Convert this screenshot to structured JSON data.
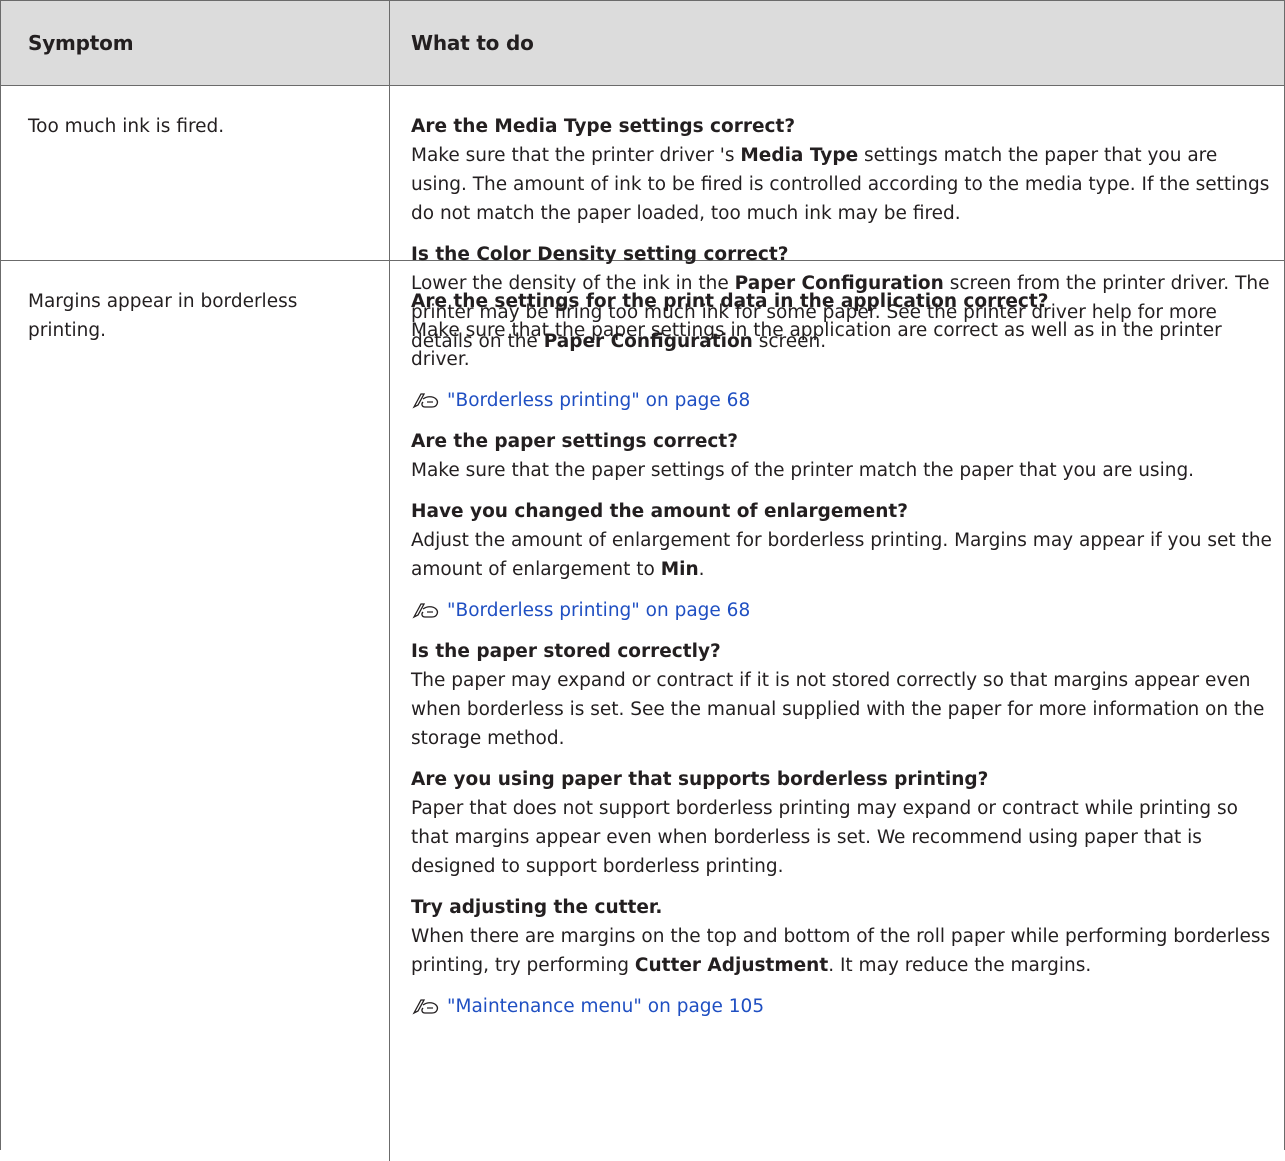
{
  "header": {
    "symptom": "Symptom",
    "what_to_do": "What to do"
  },
  "rows": [
    {
      "symptom": "Too much ink is fired.",
      "blocks": [
        {
          "question": "Are the Media Type settings correct?",
          "text_parts": [
            "Make sure that the printer driver 's ",
            "Media Type",
            " settings match the paper that you are using. The amount of ink to be fired is controlled according to the media type. If the settings do not match the paper loaded, too much ink may be fired."
          ]
        },
        {
          "question": "Is the Color Density setting correct?",
          "text_parts": [
            "Lower the density of the ink in the ",
            "Paper Configuration",
            " screen from the printer driver. The printer may be firing too much ink for some paper. See the printer driver help for more details on the ",
            "Paper Configuration",
            " screen."
          ]
        }
      ]
    },
    {
      "symptom": "Margins appear in borderless printing.",
      "blocks": [
        {
          "question": "Are the settings for the print data in the application correct?",
          "text": "Make sure that the paper settings in the application are correct as well as in the printer driver."
        },
        {
          "link": "\"Borderless printing\" on page 68"
        },
        {
          "question": "Are the paper settings correct?",
          "text": "Make sure that the paper settings of the printer match the paper that you are using."
        },
        {
          "question": "Have you changed the amount of enlargement?",
          "text_parts": [
            "Adjust the amount of enlargement for borderless printing. Margins may appear if you set the amount of enlargement to ",
            "Min",
            "."
          ]
        },
        {
          "link": "\"Borderless printing\" on page 68"
        },
        {
          "question": "Is the paper stored correctly?",
          "text": "The paper may expand or contract if it is not stored correctly so that margins appear even when borderless is set. See the manual supplied with the paper for more information on the storage method."
        },
        {
          "question": "Are you using paper that supports borderless printing?",
          "text": "Paper that does not support borderless printing may expand or contract while printing so that margins appear even when borderless is set. We recommend using paper that is designed to support borderless printing."
        },
        {
          "question": "Try adjusting the cutter.",
          "text_parts": [
            "When there are margins on the top and bottom of the roll paper while performing borderless printing, try performing ",
            "Cutter Adjustment",
            ". It may reduce the margins."
          ]
        },
        {
          "link": "\"Maintenance menu\" on page 105"
        }
      ]
    }
  ],
  "colors": {
    "header_bg": "#dcdcdc",
    "link": "#1f4fc2",
    "border": "#6b6b6b"
  }
}
